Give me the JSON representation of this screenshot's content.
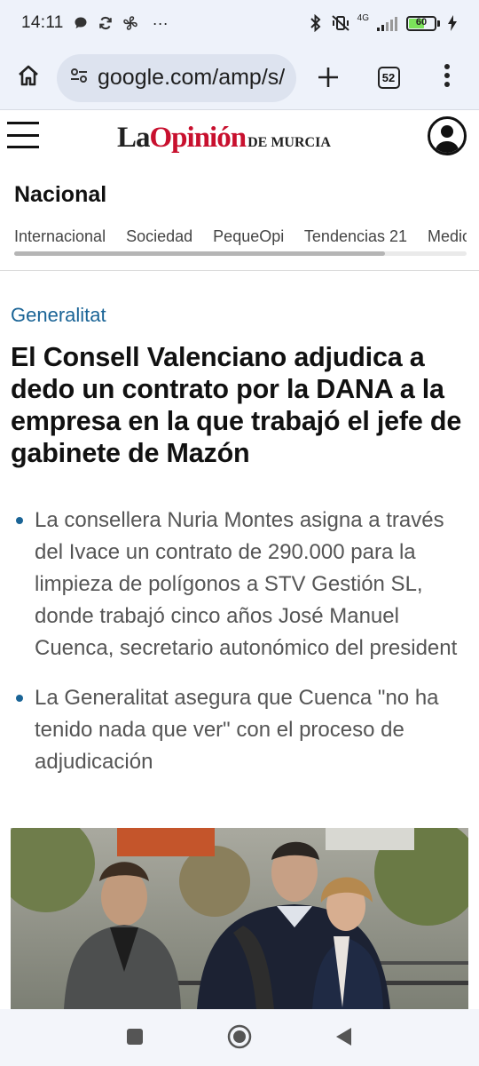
{
  "status_bar": {
    "time": "14:11",
    "more_indicator": "···",
    "network": "4G",
    "battery_level": "60",
    "icons": [
      "chat-bubble-icon",
      "sync-icon",
      "fan-icon",
      "bluetooth-icon",
      "vibrate-off-icon",
      "signal-icon",
      "charging-bolt-icon"
    ]
  },
  "browser": {
    "url": "google.com/amp/s/",
    "tab_count": "52",
    "icons": [
      "home-icon",
      "site-settings-icon",
      "new-tab-icon",
      "more-vert-icon"
    ]
  },
  "site": {
    "logo_la": "La",
    "logo_opinion": "Opinión",
    "logo_suffix": "DE MURCIA",
    "brand_color": "#c8102e"
  },
  "section": {
    "title": "Nacional",
    "nav_items": [
      "Internacional",
      "Sociedad",
      "PequeOpi",
      "Tendencias 21",
      "Medio Ambiente"
    ]
  },
  "article": {
    "kicker": "Generalitat",
    "kicker_color": "#1a6496",
    "headline": "El Consell Valenciano adjudica a dedo un contrato por la DANA a la empresa en la que trabajó el jefe de gabinete de Mazón",
    "bullets": [
      "La consellera Nuria Montes asigna a través del Ivace un contrato de 290.000 para la limpieza de polígonos a STV Gestión SL, donde trabajó cinco años José Manuel Cuenca, secretario autonómico del president",
      "La Generalitat asegura que Cuenca \"no ha tenido nada que ver\" con el proceso de adjudicación"
    ]
  },
  "nav_bar": {
    "icons": [
      "recents-square-icon",
      "home-circle-icon",
      "back-triangle-icon"
    ]
  }
}
